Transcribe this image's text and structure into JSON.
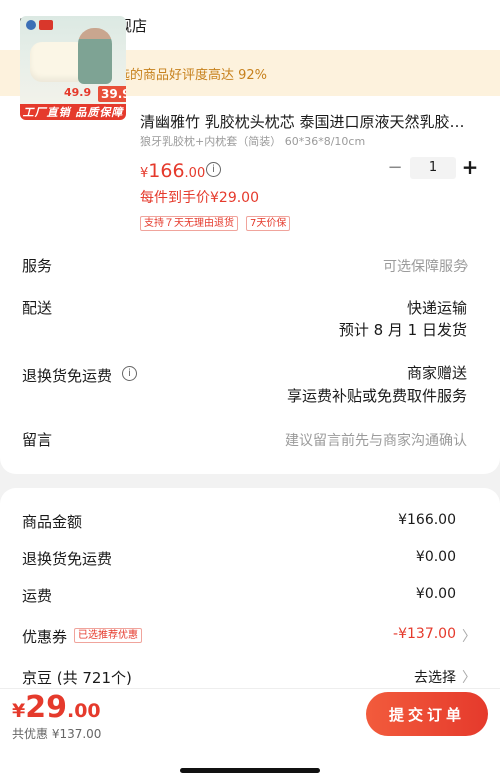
{
  "header": {
    "store_name": "清幽雅竹旗舰店",
    "icon": "store-icon"
  },
  "praise_banner": {
    "text": "恭喜你，挑选的商品好评度高达 92%",
    "icon": "thumbs-up-icon"
  },
  "product": {
    "title": "清幽雅竹 乳胶枕头枕芯 泰国进口原液天然乳胶…",
    "spec": "狼牙乳胶枕+内枕套（简装） 60*36*8/10cm",
    "price_currency": "¥",
    "price_int": "166",
    "price_dec": ".00",
    "unit_price": "每件到手价¥29.00",
    "tags": [
      "支持７天无理由退货",
      "7天价保"
    ],
    "quantity": "1",
    "minus": "−",
    "plus": "+",
    "image": {
      "price_old": "49.9",
      "price_new": "39.9",
      "banner": "工厂直销 品质保障"
    }
  },
  "rows": {
    "service": {
      "label": "服务",
      "value": "可选保障服务"
    },
    "delivery": {
      "label": "配送",
      "value": "快递运输",
      "value2": "预计 8 月 1 日发货"
    },
    "return": {
      "label": "退换货免运费",
      "value": "商家赠送",
      "value2": "享运费补贴或免费取件服务"
    },
    "message": {
      "label": "留言",
      "placeholder": "建议留言前先与商家沟通确认"
    }
  },
  "summary": {
    "goods_amount": {
      "label": "商品金额",
      "value": "¥166.00"
    },
    "return_shipping": {
      "label": "退换货免运费",
      "value": "¥0.00"
    },
    "shipping": {
      "label": "运费",
      "value": "¥0.00"
    },
    "coupon": {
      "label": "优惠券",
      "badge": "已选推荐优惠",
      "value": "-¥137.00"
    },
    "jingdou": {
      "label": "京豆 (共 721个)",
      "value": "去选择"
    }
  },
  "footer": {
    "total_currency": "¥",
    "total_int": "29",
    "total_dec": ".00",
    "saved": "共优惠 ¥137.00",
    "submit": "提交订单"
  },
  "colors": {
    "accent": "#e53a2c",
    "banner_bg": "#fdf2dd",
    "banner_text": "#c7811d"
  }
}
